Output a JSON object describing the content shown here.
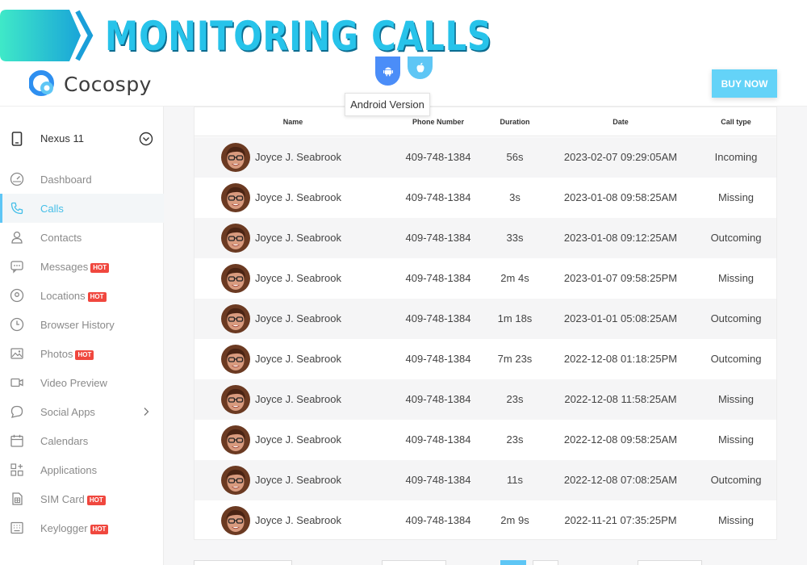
{
  "banner": {
    "title": "MONITORING CALLS"
  },
  "header": {
    "brand": "Cocospy",
    "buy_now": "BUY NOW",
    "os_tabs": [
      {
        "name": "android-icon",
        "color": "#4b8df8"
      },
      {
        "name": "apple-icon",
        "color": "#5ec6f5"
      }
    ],
    "tooltip": "Android Version"
  },
  "sidebar": {
    "device": "Nexus 11",
    "items": [
      {
        "label": "Dashboard",
        "icon": "dashboard-icon",
        "hot": false,
        "active": false
      },
      {
        "label": "Calls",
        "icon": "phone-icon",
        "hot": false,
        "active": true
      },
      {
        "label": "Contacts",
        "icon": "contacts-icon",
        "hot": false,
        "active": false
      },
      {
        "label": "Messages",
        "icon": "messages-icon",
        "hot": true,
        "active": false
      },
      {
        "label": "Locations",
        "icon": "location-icon",
        "hot": true,
        "active": false
      },
      {
        "label": "Browser History",
        "icon": "clock-icon",
        "hot": false,
        "active": false
      },
      {
        "label": "Photos",
        "icon": "photo-icon",
        "hot": true,
        "active": false
      },
      {
        "label": "Video Preview",
        "icon": "video-icon",
        "hot": false,
        "active": false
      },
      {
        "label": "Social Apps",
        "icon": "chat-icon",
        "hot": false,
        "active": false,
        "chevron": true
      },
      {
        "label": "Calendars",
        "icon": "calendar-icon",
        "hot": false,
        "active": false
      },
      {
        "label": "Applications",
        "icon": "apps-icon",
        "hot": false,
        "active": false
      },
      {
        "label": "SIM Card",
        "icon": "sim-icon",
        "hot": true,
        "active": false
      },
      {
        "label": "Keylogger",
        "icon": "keyboard-icon",
        "hot": true,
        "active": false
      }
    ],
    "hot_label": "HOT"
  },
  "table": {
    "columns": [
      "Name",
      "Phone Number",
      "Duration",
      "Date",
      "Call type"
    ],
    "rows": [
      [
        "Joyce J. Seabrook",
        "409-748-1384",
        "56s",
        "2023-02-07 09:29:05AM",
        "Incoming"
      ],
      [
        "Joyce J. Seabrook",
        "409-748-1384",
        "3s",
        "2023-01-08 09:58:25AM",
        "Missing"
      ],
      [
        "Joyce J. Seabrook",
        "409-748-1384",
        "33s",
        "2023-01-08 09:12:25AM",
        "Outcoming"
      ],
      [
        "Joyce J. Seabrook",
        "409-748-1384",
        "2m 4s",
        "2023-01-07 09:58:25PM",
        "Missing"
      ],
      [
        "Joyce J. Seabrook",
        "409-748-1384",
        "1m 18s",
        "2023-01-01 05:08:25AM",
        "Outcoming"
      ],
      [
        "Joyce J. Seabrook",
        "409-748-1384",
        "7m 23s",
        "2022-12-08 01:18:25PM",
        "Outcoming"
      ],
      [
        "Joyce J. Seabrook",
        "409-748-1384",
        "23s",
        "2022-12-08 11:58:25AM",
        "Missing"
      ],
      [
        "Joyce J. Seabrook",
        "409-748-1384",
        "23s",
        "2022-12-08 09:58:25AM",
        "Missing"
      ],
      [
        "Joyce J. Seabrook",
        "409-748-1384",
        "11s",
        "2022-12-08 07:08:25AM",
        "Outcoming"
      ],
      [
        "Joyce J. Seabrook",
        "409-748-1384",
        "2m 9s",
        "2022-11-21 07:35:25PM",
        "Missing"
      ]
    ]
  },
  "colors": {
    "accent": "#5ec6f5",
    "title": "#27c3ea",
    "hot": "#f0473e"
  }
}
